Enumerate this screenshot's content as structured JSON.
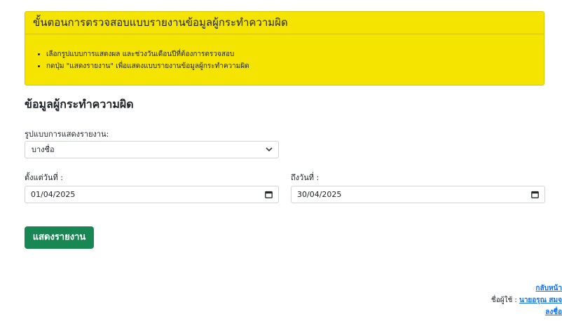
{
  "notice": {
    "title": "ขั้นตอนการตรวจสอบแบบรายงานข้อมูลผู้กระทำความผิด",
    "steps": [
      "เลือกรูปแบบการแสดงผล และช่วงวันเดือนปีที่ต้องการตรวจสอบ",
      "กดปุ่ม \"แสดงรายงาน\" เพื่อแสดงแบบรายงานข้อมูลผู้กระทำความผิด"
    ]
  },
  "section_title": "ข้อมูลผู้กระทำความผิด",
  "form": {
    "format_label": "รูปแบบการแสดงรายงาน:",
    "format_value": "บางชื่อ",
    "from_label": "ตั้งแต่วันที่ :",
    "from_value": "01/04/2025",
    "to_label": "ถึงวันที่ :",
    "to_value": "30/04/2025",
    "submit_label": "แสดงรายงาน"
  },
  "footer": {
    "back_link": "กลับหน้า",
    "user_label": "ชื่อผู้ใช้ :",
    "user_name": "นายอรุณ สมจ",
    "logout_link": "ลงชื่อ"
  },
  "colors": {
    "notice_bg": "#f5e400",
    "button_bg": "#198754",
    "link": "#0d6efd"
  }
}
